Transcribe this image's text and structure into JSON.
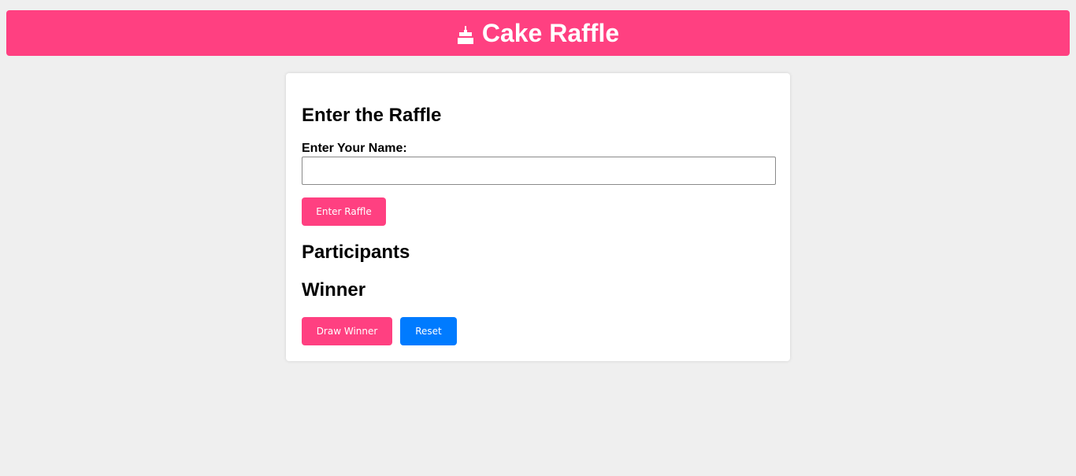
{
  "header": {
    "icon": "birthday-cake-icon",
    "title": "Cake Raffle"
  },
  "entry_section": {
    "heading": "Enter the Raffle",
    "name_label": "Enter Your Name:",
    "name_value": "",
    "name_placeholder": "",
    "enter_button": "Enter Raffle"
  },
  "participants_section": {
    "heading": "Participants"
  },
  "winner_section": {
    "heading": "Winner",
    "draw_button": "Draw Winner",
    "reset_button": "Reset"
  },
  "colors": {
    "accent": "#ff4081",
    "reset": "#007bff",
    "background": "#efefef"
  }
}
